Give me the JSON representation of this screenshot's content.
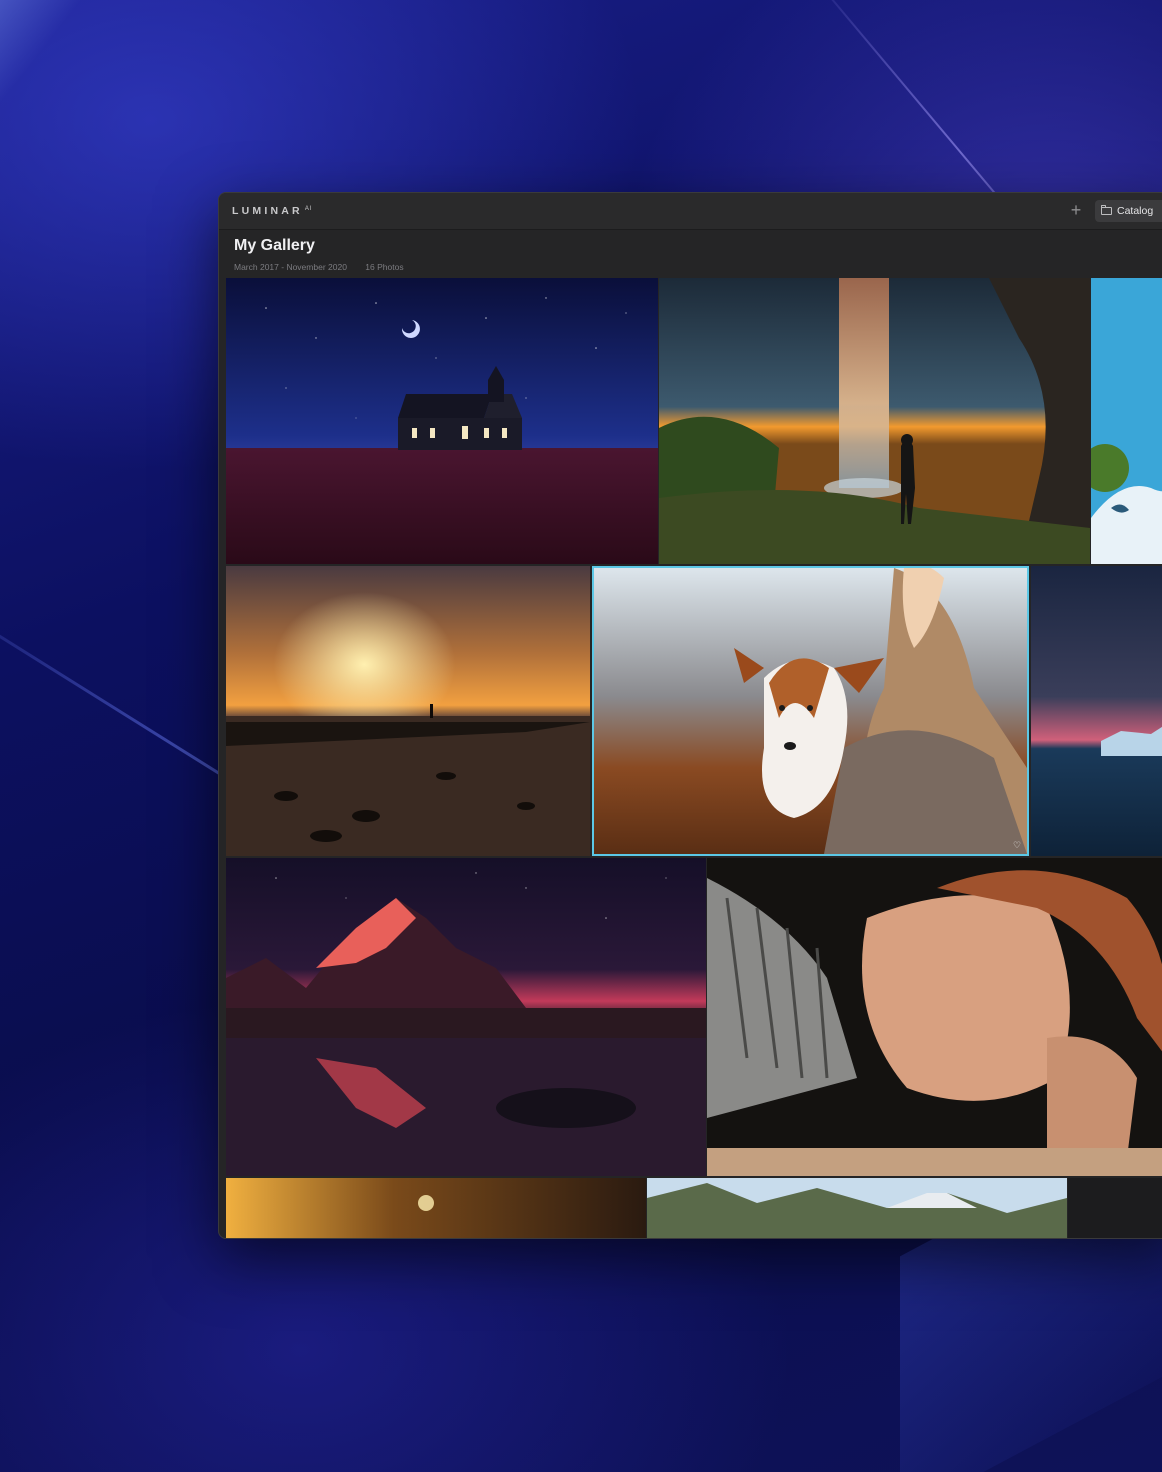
{
  "app": {
    "logo": "LUMINAR",
    "logo_sup": "AI",
    "plus_label": "+",
    "catalog_label": "Catalog"
  },
  "gallery": {
    "title": "My Gallery",
    "date_range": "March 2017 - November 2020",
    "count": "16 Photos"
  },
  "photos": [
    {
      "subject": "church at night"
    },
    {
      "subject": "waterfall at sunset"
    },
    {
      "subject": "snowy tree"
    },
    {
      "subject": "sunset over pier"
    },
    {
      "subject": "dog held by woman",
      "selected": true,
      "favorite_icon": "heart-icon"
    },
    {
      "subject": "iceberg at dusk"
    },
    {
      "subject": "mountain at night"
    },
    {
      "subject": "portrait of young man"
    },
    {
      "subject": "cafe interior"
    },
    {
      "subject": "mountain range"
    },
    {
      "subject": "dark landscape"
    }
  ],
  "colors": {
    "selection": "#5cc8e6",
    "window_bg": "#252526"
  }
}
